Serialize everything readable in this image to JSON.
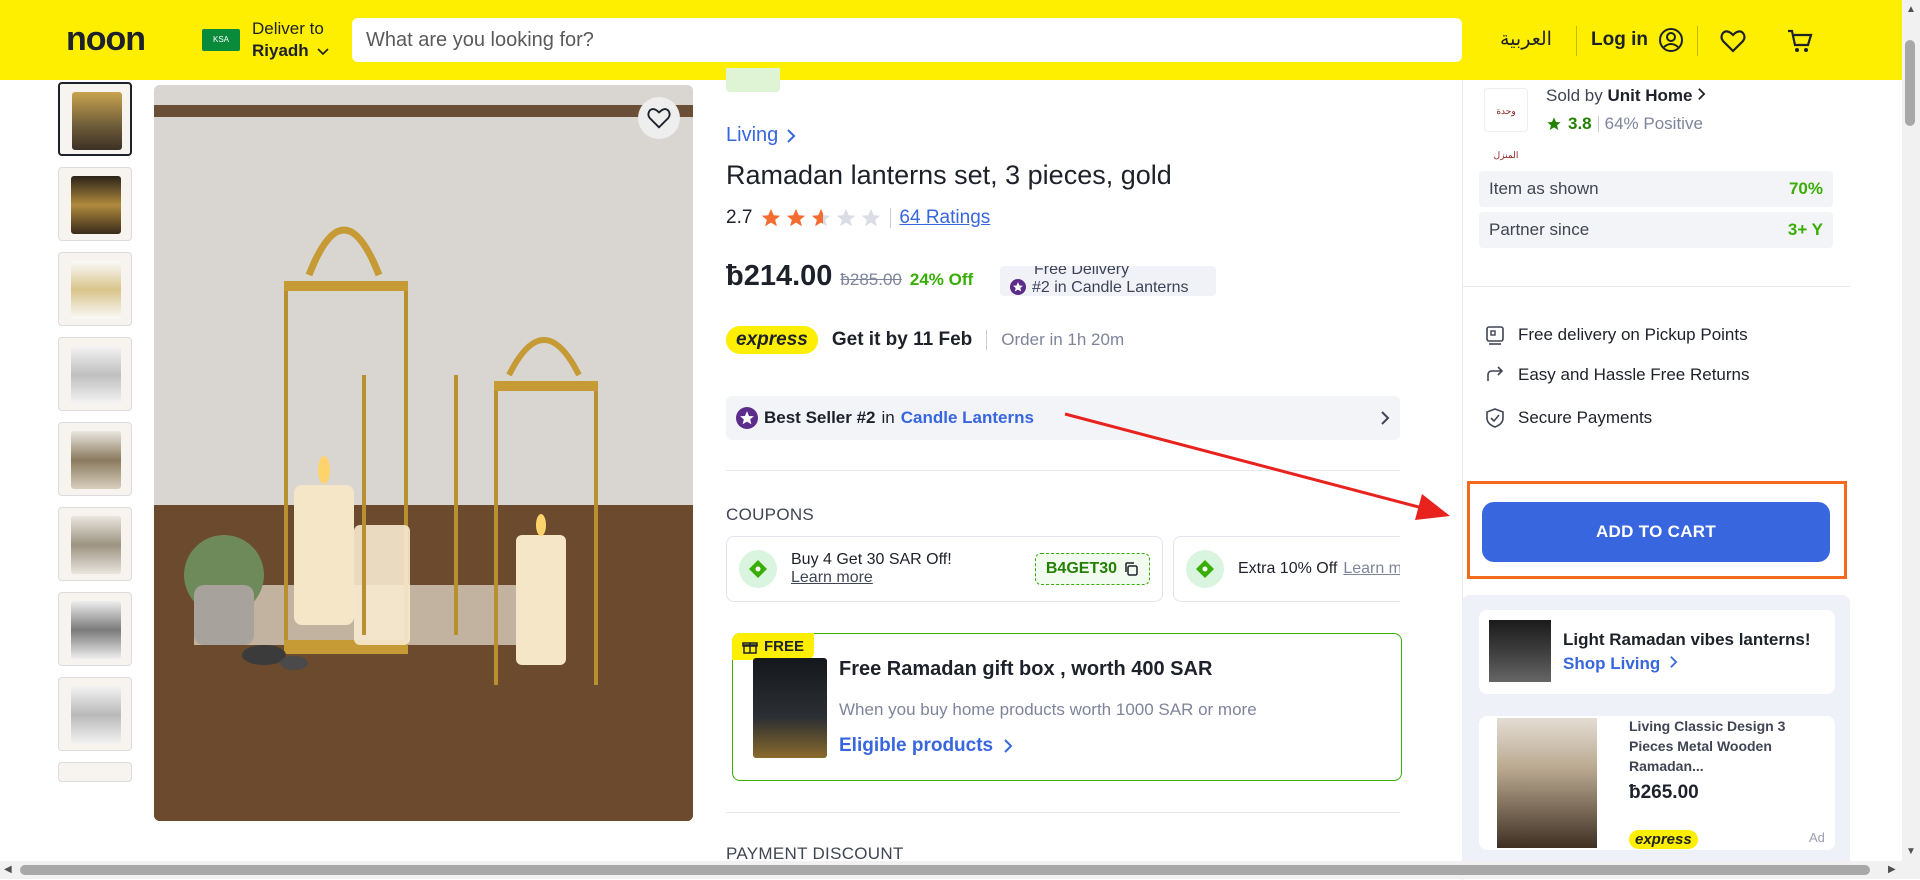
{
  "header": {
    "logo": "noon",
    "flag_text": "KSA",
    "deliver_to": "Deliver to",
    "city": "Riyadh",
    "search_placeholder": "What are you looking for?",
    "language": "العربية",
    "login": "Log in"
  },
  "product": {
    "breadcrumb": "Living",
    "title": "Ramadan lanterns set, 3 pieces, gold",
    "rating": "2.7",
    "ratings_link": "64 Ratings",
    "currency_glyph": "ƀ",
    "price": "214.00",
    "old_price": "285.00",
    "discount": "24% Off",
    "free_delivery": "Free Delivery",
    "rank_badge": "#2 in Candle Lanterns",
    "express": "express",
    "delivery": "Get it by 11 Feb",
    "order_in": "Order in 1h 20m",
    "bestseller_rank": "Best Seller #2",
    "bestseller_in": "in",
    "bestseller_category": "Candle Lanterns"
  },
  "coupons": {
    "label": "COUPONS",
    "items": [
      {
        "title": "Buy 4 Get 30 SAR Off!",
        "learn": "Learn more",
        "code": "B4GET30"
      },
      {
        "title": "Extra 10% Off",
        "learn": "Learn more"
      }
    ]
  },
  "gift": {
    "badge": "FREE",
    "title": "Free Ramadan gift box , worth 400 SAR",
    "subtitle": "When you buy home products worth 1000 SAR or more",
    "link": "Eligible products"
  },
  "payment": {
    "label": "PAYMENT DISCOUNT"
  },
  "seller": {
    "logo_text": "وحدة المنزل",
    "sold_by": "Sold by",
    "name": "Unit Home",
    "rating": "3.8",
    "positive": "64% Positive",
    "stats": [
      {
        "label": "Item as shown",
        "value": "70%"
      },
      {
        "label": "Partner since",
        "value": "3+ Y"
      }
    ]
  },
  "perks": [
    "Free delivery on Pickup Points",
    "Easy and Hassle Free Returns",
    "Secure Payments"
  ],
  "cart": {
    "button": "ADD TO CART"
  },
  "promo": {
    "title": "Light Ramadan vibes lanterns!",
    "link": "Shop Living"
  },
  "ad": {
    "title": "Living Classic Design 3 Pieces Metal Wooden Ramadan...",
    "price": "265.00",
    "express": "express",
    "label": "Ad"
  },
  "colors": {
    "brand_yellow": "#feee00",
    "link_blue": "#3866df",
    "green": "#38ae04",
    "star": "#f36c32",
    "highlight": "#f26b1d",
    "arrow": "#e8231e"
  }
}
